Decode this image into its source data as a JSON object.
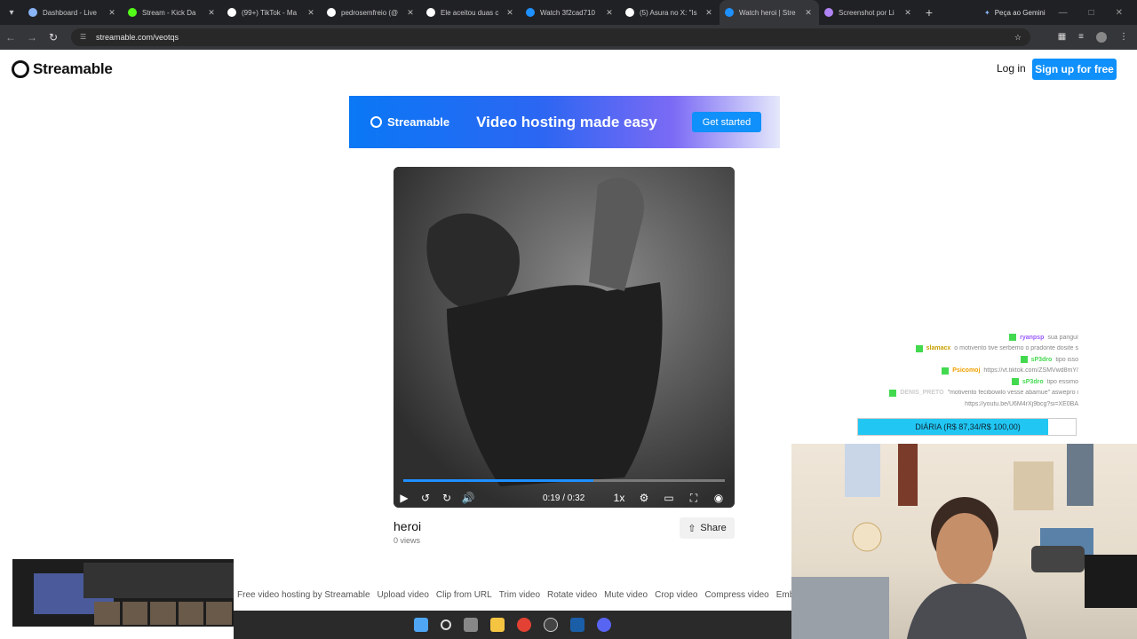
{
  "browser": {
    "tabs": [
      {
        "title": "Dashboard - Live",
        "color": "#8ab4f8"
      },
      {
        "title": "Stream - Kick Da",
        "color": "#53fc18"
      },
      {
        "title": "(99+) TikTok - Ma",
        "color": "#ffffff"
      },
      {
        "title": "pedrosemfreio (@",
        "color": "#ffffff"
      },
      {
        "title": "Ele aceitou duas c",
        "color": "#ffffff"
      },
      {
        "title": "Watch 3f2cad710",
        "color": "#1e90ff"
      },
      {
        "title": "(5) Asura no X: \"Is",
        "color": "#ffffff"
      },
      {
        "title": "Watch heroi | Stre",
        "color": "#1e90ff"
      },
      {
        "title": "Screenshot por Li",
        "color": "#b084f5"
      }
    ],
    "active_tab_index": 7,
    "gemini_label": "Peça ao Gemini",
    "url": "streamable.com/veotqs"
  },
  "page": {
    "brand": "Streamable",
    "login_label": "Log in",
    "signup_label": "Sign up for free",
    "banner": {
      "brand": "Streamable",
      "tagline": "Video hosting made easy",
      "cta": "Get started"
    },
    "video": {
      "current_time": "0:19",
      "duration": "0:32",
      "time_display": "0:19 / 0:32",
      "progress_fraction": 0.59,
      "speed": "1x",
      "title": "heroi",
      "views": "0 views",
      "share_label": "Share"
    },
    "footer_links": [
      "Free video hosting by Streamable",
      "Upload video",
      "Clip from URL",
      "Trim video",
      "Rotate video",
      "Mute video",
      "Crop video",
      "Compress video",
      "Embed vid"
    ]
  },
  "overlay": {
    "chat": [
      {
        "user": "ryanpsp",
        "user_color": "#9b59ff",
        "msg": "sua panguí"
      },
      {
        "user": "slamacx",
        "user_color": "#c8a000",
        "msg": "o motivento tive serbemo o pradonte dosite s"
      },
      {
        "user": "sP3dro",
        "user_color": "#43d94f",
        "msg": "tipo isso"
      },
      {
        "user": "Psicomoj",
        "user_color": "#f0a000",
        "msg": "https://vt.tiktok.com/ZSMVwd8mY/"
      },
      {
        "user": "sP3dro",
        "user_color": "#43d94f",
        "msg": "tipo essimo"
      },
      {
        "user": "DENIS_PRETO",
        "user_color": "#cccccc",
        "msg": "\"motivento fecibowilo vesse abamue\" aswepro i"
      },
      {
        "user": "",
        "user_color": "#cccccc",
        "msg": "https://youtu.be/U6M4rXj9bcg?si=XE0BA"
      }
    ],
    "goal": {
      "label": "DIÁRIA (R$ 87,34/R$ 100,00)",
      "fraction": 0.8734,
      "color": "#21c7f2"
    }
  }
}
